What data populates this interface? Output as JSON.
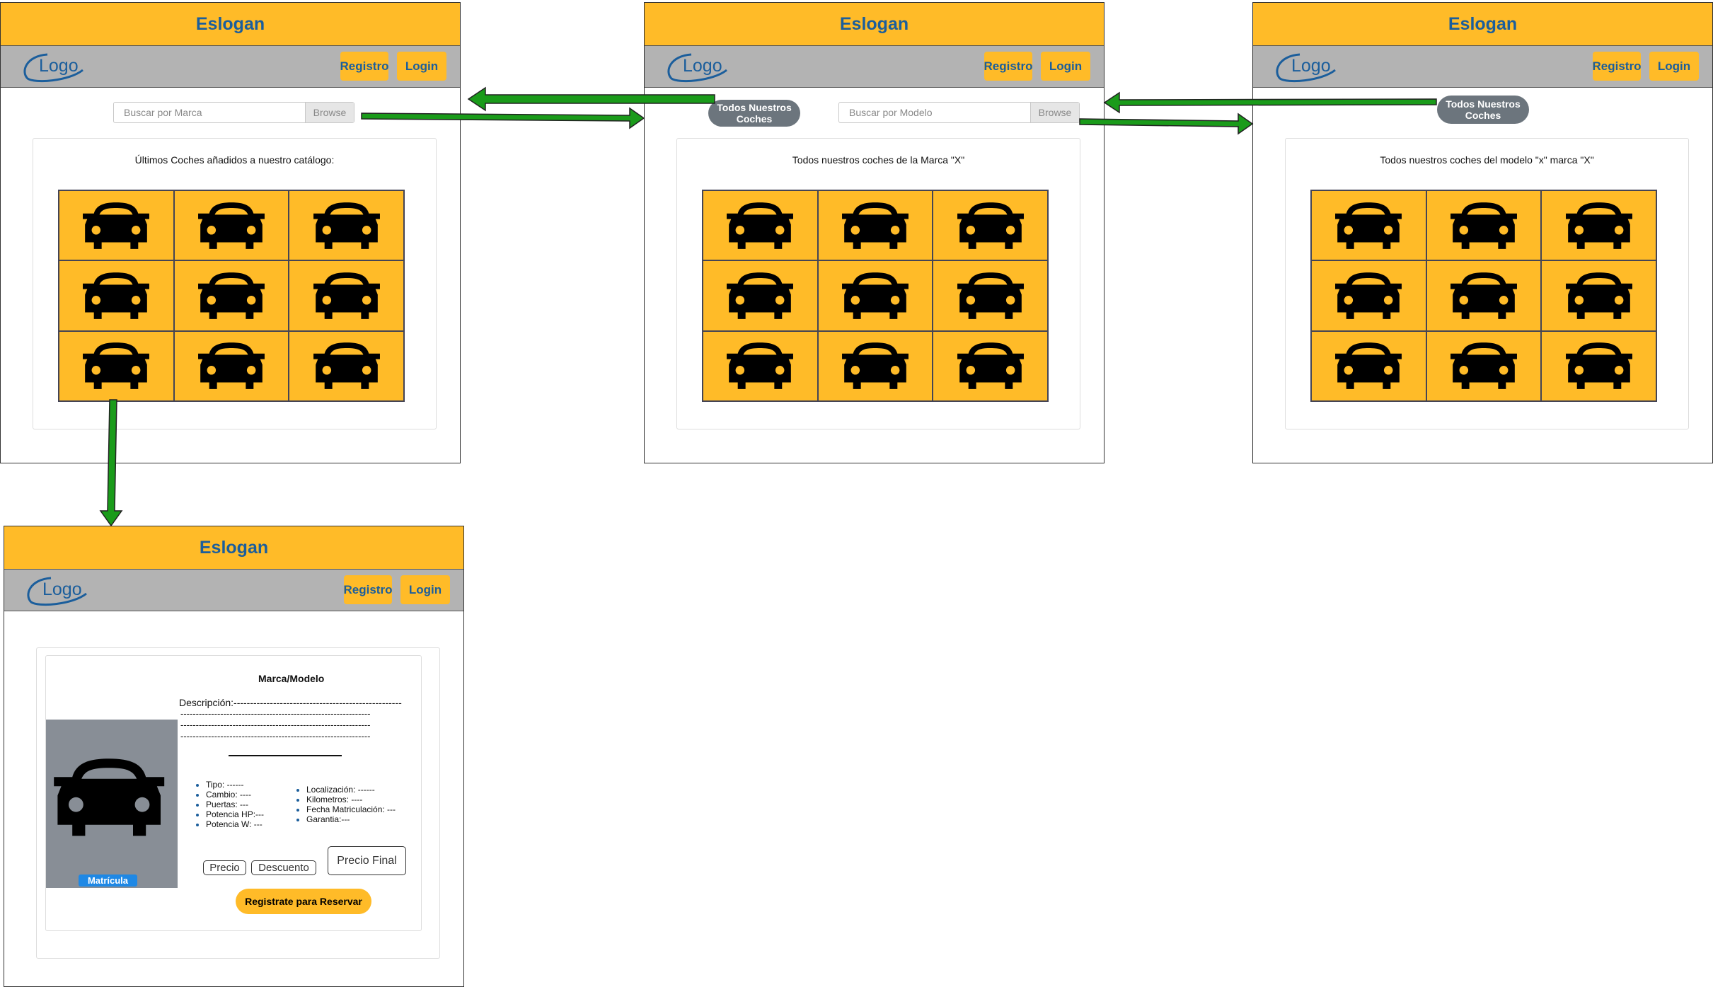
{
  "colors": {
    "accent": "#ffbb28",
    "brand_text": "#1b5e9c",
    "nav_bg": "#b3b3b3",
    "arrow": "#1a9b1a",
    "pill": "#6c757d",
    "badge": "#1e88e5"
  },
  "header": {
    "slogan": "Eslogan",
    "logo": "Logo",
    "register": "Registro",
    "login": "Login"
  },
  "home": {
    "search_placeholder": "Buscar por Marca",
    "browse": "Browse",
    "catalog_title": "Últimos Coches añadidos a nuestro catálogo:"
  },
  "brand_page": {
    "all_cars_button": "Todos Nuestros Coches",
    "search_placeholder": "Buscar por Modelo",
    "browse": "Browse",
    "catalog_title": "Todos nuestros coches de la Marca \"X\""
  },
  "model_page": {
    "all_cars_button": "Todos Nuestros Coches",
    "catalog_title": "Todos nuestros coches del modelo \"x\" marca \"X\""
  },
  "detail": {
    "title": "Marca/Modelo",
    "description_lines": [
      "Descripción:---------------------------------------------------",
      "--------------------------------------------------------------",
      "--------------------------------------------------------------",
      "--------------------------------------------------------------"
    ],
    "plate": "Matrícula",
    "features_left": [
      "Tipo: ------",
      "Cambio: ----",
      "Puertas: ---",
      "Potencia HP:---",
      "Potencia W: ---"
    ],
    "features_right": [
      "Localización: ------",
      "Kilometros: ----",
      "Fecha Matriculación: ---",
      "Garantia:---"
    ],
    "price": "Precio",
    "discount": "Descuento",
    "final_price": "Precio Final",
    "reserve": "Registrate para Reservar"
  },
  "icons": {
    "car": "car-icon"
  }
}
